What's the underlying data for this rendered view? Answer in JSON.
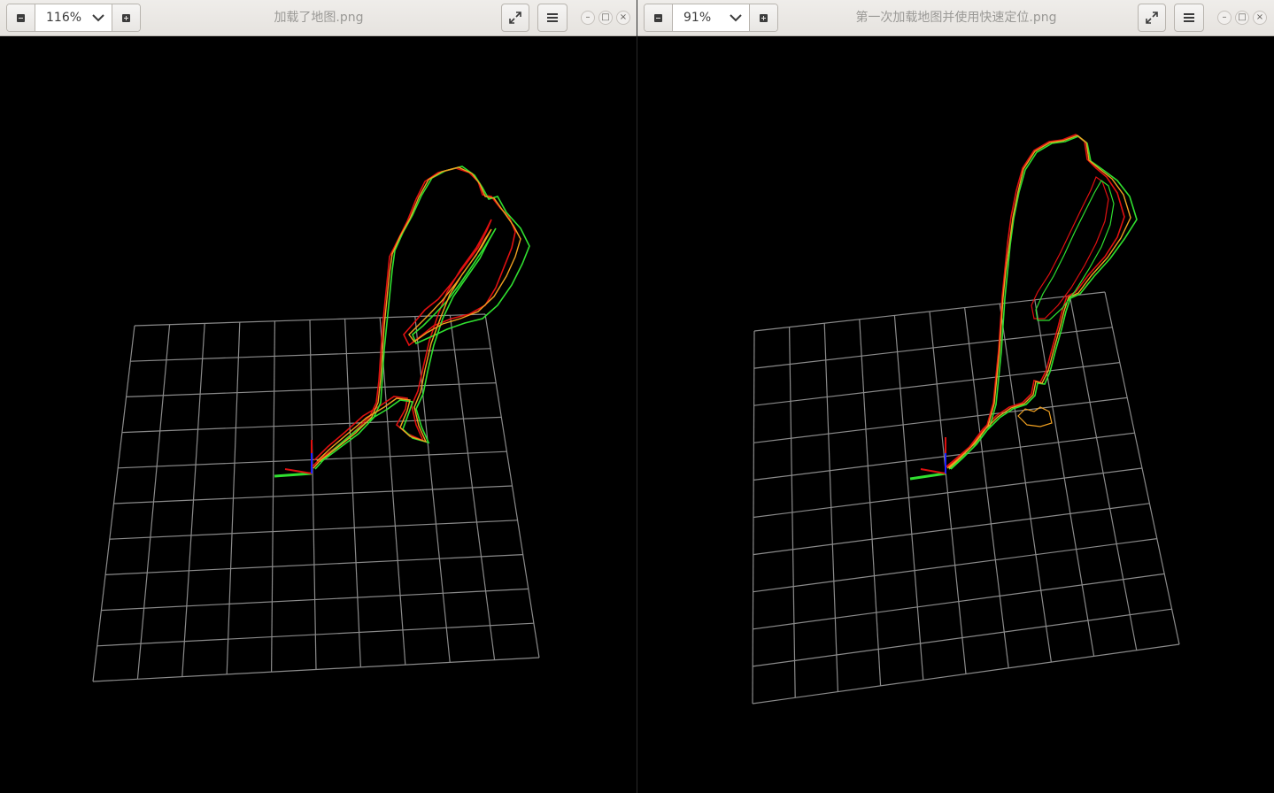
{
  "left": {
    "title": "加载了地图.png",
    "zoom": "116%",
    "window_controls": {
      "minimize": "–",
      "maximize": "□",
      "close": "×"
    }
  },
  "right": {
    "title": "第一次加载地图并使用快速定位.png",
    "zoom": "91%",
    "window_controls": {
      "minimize": "–",
      "maximize": "□",
      "close": "×"
    }
  },
  "icons": {
    "zoom_out": "zoom-out-icon",
    "zoom_in": "zoom-in-icon",
    "dropdown": "chevron-down-icon",
    "fullscreen": "fullscreen-icon",
    "menu": "hamburger-menu-icon"
  },
  "colors": {
    "grid": "#8a8a8a",
    "trajectory_red": "#e01010",
    "trajectory_green": "#30e030",
    "trajectory_orange": "#f0a020",
    "axis_blue": "#2020ff",
    "background": "#000000"
  }
}
